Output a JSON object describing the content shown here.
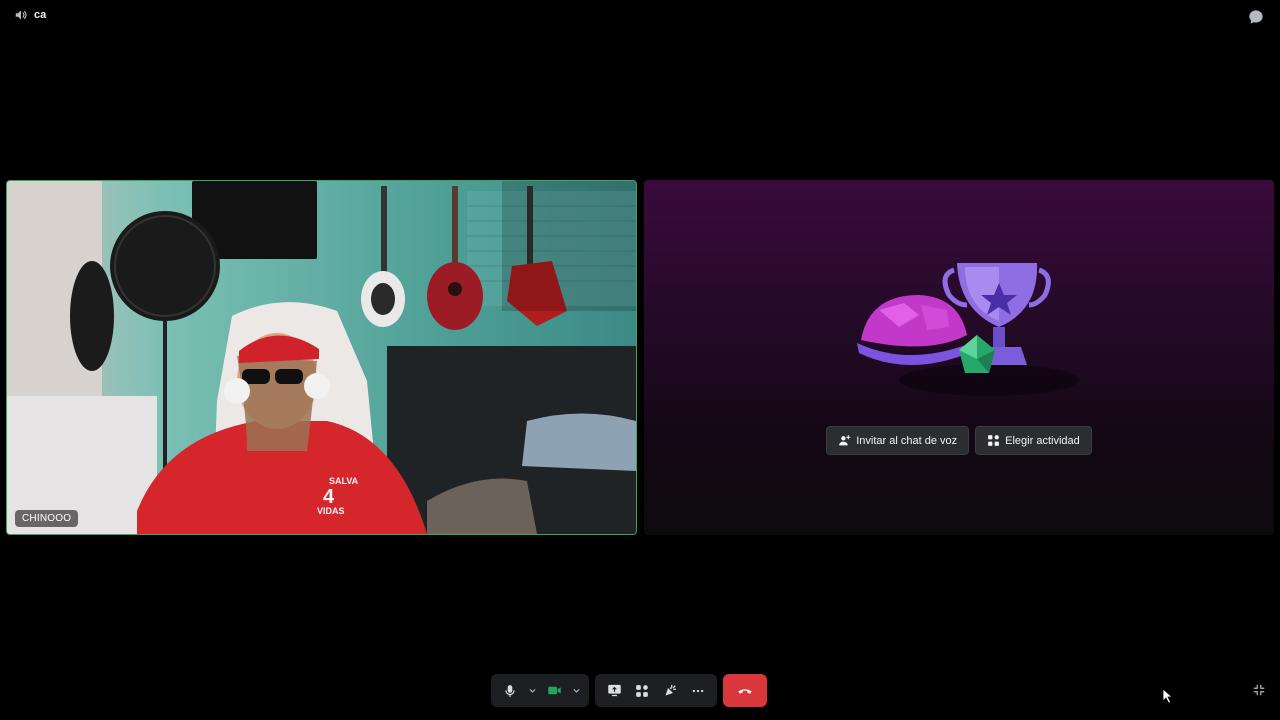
{
  "channel": {
    "name": "ca",
    "icon": "speaker-icon"
  },
  "topbar": {
    "chat_icon": "chat-bubble-icon"
  },
  "participant": {
    "name": "CHINOOO",
    "shirt_text": [
      "SALVA",
      "4",
      "VIDAS"
    ]
  },
  "activity": {
    "invite_label": "Invitar al chat de voz",
    "invite_icon": "add-person-icon",
    "choose_label": "Elegir actividad",
    "choose_icon": "activities-icon"
  },
  "controls": {
    "mic_icon": "microphone-icon",
    "camera_icon": "camera-icon",
    "screen_share_icon": "screen-share-icon",
    "activities_icon": "rocket-grid-icon",
    "soundboard_icon": "soundboard-icon",
    "more_icon": "more-icon",
    "hangup_icon": "phone-hangup-icon",
    "fullscreen_icon": "exit-fullscreen-icon"
  },
  "colors": {
    "speaking_border": "#3ba55d",
    "camera_active": "#23a55a",
    "hangup": "#da373c",
    "button_bg": "#2b2d31"
  }
}
